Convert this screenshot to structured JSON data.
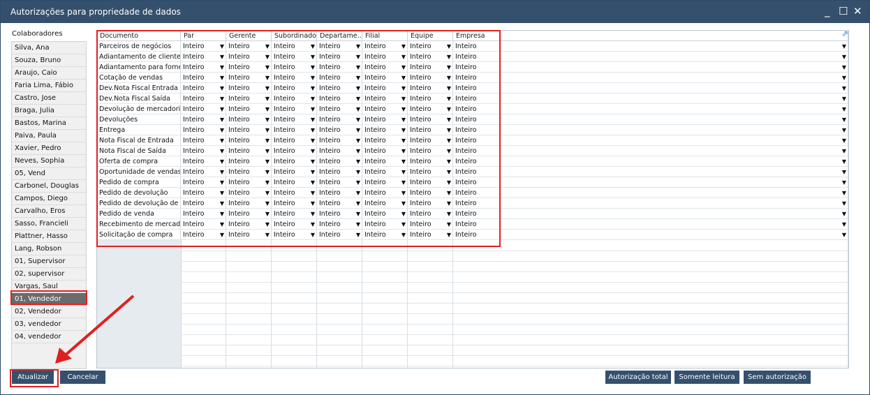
{
  "window": {
    "title": "Autorizações para propriedade de dados"
  },
  "employees": {
    "header": "Colaboradores",
    "items": [
      "Silva, Ana",
      "Souza, Bruno",
      "Araujo, Caio",
      "Faria Lima, Fábio",
      "Castro, Jose",
      "Braga, Julia",
      "Bastos, Marina",
      "Paiva, Paula",
      "Xavier, Pedro",
      "Neves, Sophia",
      "05, Vend",
      "Carbonel, Douglas",
      "Campos, Diego",
      "Carvalho, Eros",
      "Sasso, Francieli",
      "Plattner, Hasso",
      "Lang, Robson",
      "01, Supervisor",
      "02, supervisor",
      "Vargas, Saul",
      "01, Vendedor",
      "02, Vendedor",
      "03, vendedor",
      "04, vendedor"
    ],
    "selected": "01, Vendedor"
  },
  "grid": {
    "columns": [
      "Documento",
      "Par",
      "Gerente",
      "Subordinado",
      "Departame...",
      "Filial",
      "Equipe",
      "Empresa"
    ],
    "documents": [
      "Parceiros de negócios",
      "Adiantamento de cliente",
      "Adiantamento para fornec",
      "Cotação de vendas",
      "Dev.Nota Fiscal Entrada",
      "Dev.Nota Fiscal Saída",
      "Devolução de mercadorias",
      "Devoluções",
      "Entrega",
      "Nota Fiscal de Entrada",
      "Nota Fiscal de Saída",
      "Oferta de compra",
      "Oportunidade de vendas",
      "Pedido de compra",
      "Pedido de devolução",
      "Pedido de devolução de m",
      "Pedido de venda",
      "Recebimento de mercador",
      "Solicitação de compra"
    ],
    "value": "Inteiro"
  },
  "buttons": {
    "update": "Atualizar",
    "cancel": "Cancelar",
    "full": "Autorização total",
    "readonly": "Somente leitura",
    "none": "Sem autorização"
  }
}
